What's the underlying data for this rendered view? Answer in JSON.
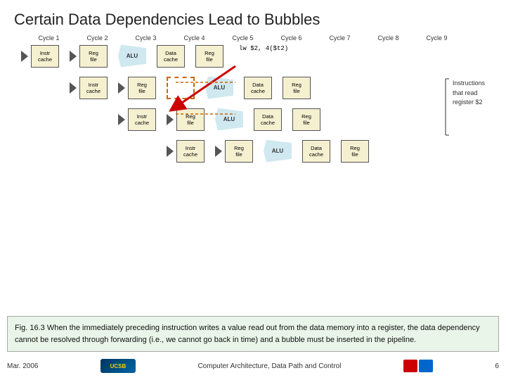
{
  "title": "Certain Data Dependencies Lead to Bubbles",
  "cycles": [
    "Cycle 1",
    "Cycle 2",
    "Cycle 3",
    "Cycle 4",
    "Cycle 5",
    "Cycle 6",
    "Cycle 7",
    "Cycle 8",
    "Cycle 9"
  ],
  "stages": {
    "instr_cache": "Instr\ncache",
    "reg_file": "Reg\nfile",
    "alu": "ALU",
    "data_cache": "Data\ncache",
    "reg_file2": "Reg\nfile"
  },
  "instr_code": "lw $2, 4($t2)",
  "note": "Instructions\nthat read\nregister $2",
  "caption": "Fig. 16.3   When the immediately preceding instruction writes a value read out from the data memory into a register, the data dependency cannot be resolved through forwarding (i.e., we cannot go back in time) and a bubble must be inserted in the pipeline.",
  "footer": {
    "date": "Mar. 2006",
    "course": "Computer Architecture, Data Path and Control",
    "page": "6"
  }
}
